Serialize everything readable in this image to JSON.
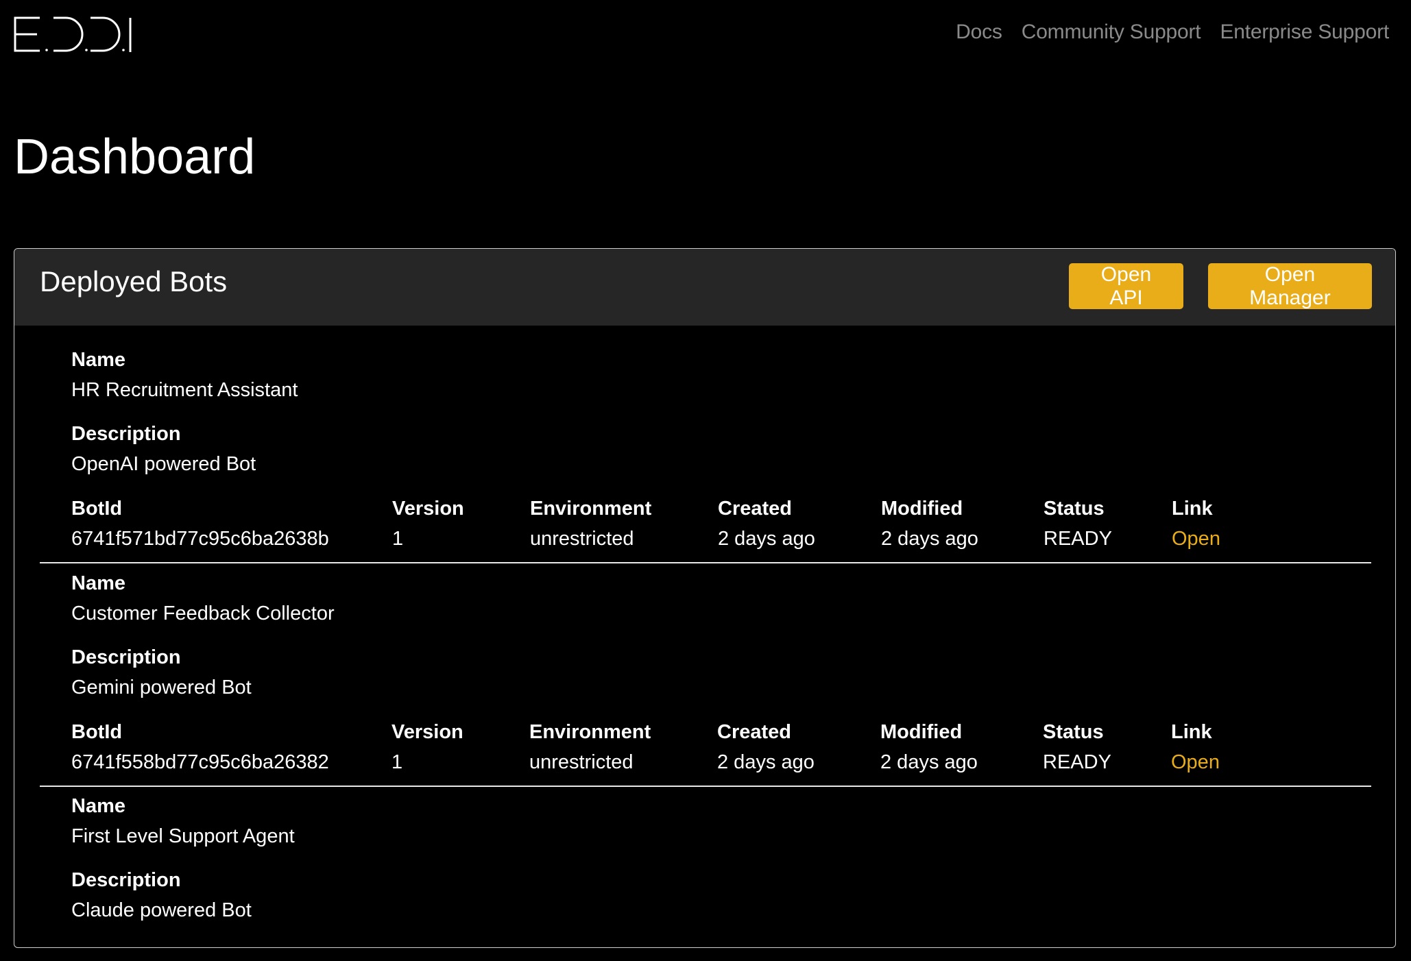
{
  "brand": {
    "logo_text": "E.D.D.I"
  },
  "nav": {
    "links": [
      {
        "label": "Docs"
      },
      {
        "label": "Community Support"
      },
      {
        "label": "Enterprise Support"
      }
    ]
  },
  "page": {
    "title": "Dashboard"
  },
  "deployed_bots": {
    "title": "Deployed Bots",
    "buttons": {
      "open_api": "Open API",
      "open_manager": "Open Manager"
    },
    "labels": {
      "name": "Name",
      "description": "Description",
      "bot_id": "BotId",
      "version": "Version",
      "environment": "Environment",
      "created": "Created",
      "modified": "Modified",
      "status": "Status",
      "link": "Link"
    },
    "colors": {
      "accent": "#E9AD19",
      "header_bg": "#262626"
    },
    "bots": [
      {
        "name": "HR Recruitment Assistant",
        "description": "OpenAI powered Bot",
        "bot_id": "6741f571bd77c95c6ba2638b",
        "version": "1",
        "environment": "unrestricted",
        "created": "2 days ago",
        "modified": "2 days ago",
        "status": "READY",
        "link": "Open"
      },
      {
        "name": "Customer Feedback Collector",
        "description": "Gemini powered Bot",
        "bot_id": "6741f558bd77c95c6ba26382",
        "version": "1",
        "environment": "unrestricted",
        "created": "2 days ago",
        "modified": "2 days ago",
        "status": "READY",
        "link": "Open"
      },
      {
        "name": "First Level Support Agent",
        "description": "Claude powered Bot"
      }
    ]
  }
}
